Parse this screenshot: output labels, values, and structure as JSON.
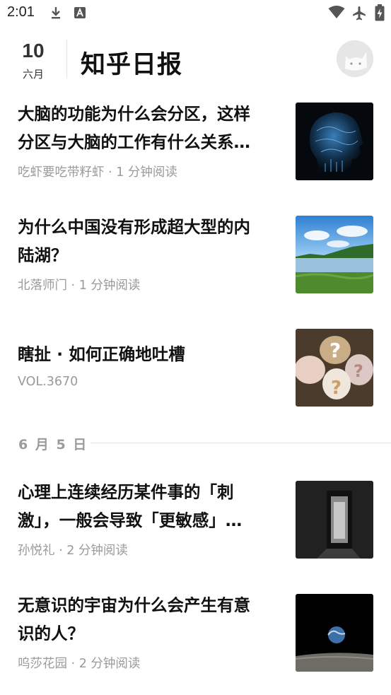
{
  "status_bar": {
    "time": "2:01"
  },
  "header": {
    "day": "10",
    "month": "六月",
    "title": "知乎日报"
  },
  "stories_today": [
    {
      "title_line1": "大脑的功能为什么会分区，这样",
      "title_line2": "分区与大脑的工作有什么关系…",
      "hint": "吃虾要吃带籽虾 · 1 分钟阅读",
      "image": "brain-image"
    },
    {
      "title_line1": "为什么中国没有形成超大型的内",
      "title_line2": "陆湖？",
      "hint": "北落师门 · 1 分钟阅读",
      "image": "lake-image"
    },
    {
      "title_line1": "瞎扯 · 如何正确地吐槽",
      "title_line2": "",
      "hint": "VOL.3670",
      "image": "question-marks-image"
    }
  ],
  "section": {
    "date_label": "6 月 5 日"
  },
  "stories_section": [
    {
      "title_line1": "心理上连续经历某件事的「刺",
      "title_line2": "激」，一般会导致「更敏感」…",
      "hint": "孙悦礼 · 2 分钟阅读",
      "image": "doorway-image"
    },
    {
      "title_line1": "无意识的宇宙为什么会产生有意",
      "title_line2": "识的人？",
      "hint": "呜莎花园 · 2 分钟阅读",
      "image": "earthrise-image"
    }
  ]
}
